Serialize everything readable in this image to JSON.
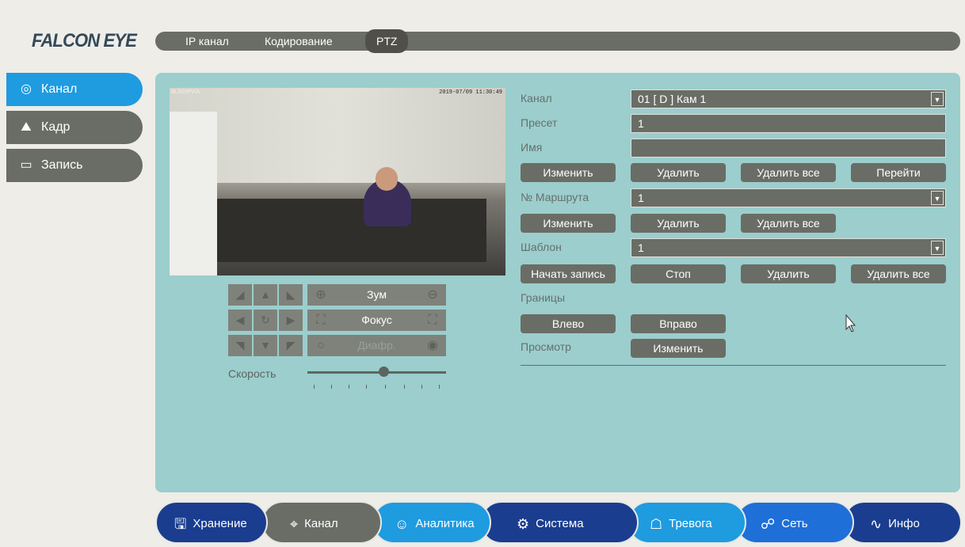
{
  "brand": "FALCON EYE",
  "top_tabs": [
    {
      "label": "IP канал"
    },
    {
      "label": "Кодирование"
    },
    {
      "label": "PTZ"
    }
  ],
  "sidebar": [
    {
      "label": "Канал",
      "icon": "camera-icon",
      "active": true
    },
    {
      "label": "Кадр",
      "icon": "image-icon",
      "active": false
    },
    {
      "label": "Запись",
      "icon": "video-record-icon",
      "active": false
    }
  ],
  "video": {
    "camera_name": "BL500PV/A",
    "timestamp": "2019-07/09 11:30:49"
  },
  "ptz": {
    "zoom_label": "Зум",
    "focus_label": "Фокус",
    "iris_label": "Диафр.",
    "speed_label": "Скорость",
    "speed_value": 0.55
  },
  "form": {
    "channel_label": "Канал",
    "channel_value": "01 [ D ] Кам 1",
    "preset_label": "Пресет",
    "preset_value": "1",
    "name_label": "Имя",
    "name_value": "",
    "preset_buttons": [
      "Изменить",
      "Удалить",
      "Удалить все",
      "Перейти"
    ],
    "route_label": "№ Маршрута",
    "route_value": "1",
    "route_buttons": [
      "Изменить",
      "Удалить",
      "Удалить все"
    ],
    "pattern_label": "Шаблон",
    "pattern_value": "1",
    "pattern_buttons": [
      "Начать запись",
      "Стоп",
      "Удалить",
      "Удалить все"
    ],
    "limits_label": "Границы",
    "limits_buttons": [
      "Влево",
      "Вправо"
    ],
    "view_label": "Просмотр",
    "view_button": "Изменить"
  },
  "bottom_nav": [
    {
      "label": "Хранение",
      "icon": "save-icon",
      "color": "#1a3d8f"
    },
    {
      "label": "Канал",
      "icon": "camera-icon",
      "color": "#6a6d65"
    },
    {
      "label": "Аналитика",
      "icon": "brain-icon",
      "color": "#1f9be0"
    },
    {
      "label": "Система",
      "icon": "gear-icon",
      "color": "#1a3d8f"
    },
    {
      "label": "Тревога",
      "icon": "alarm-icon",
      "color": "#1f9be0"
    },
    {
      "label": "Сеть",
      "icon": "network-icon",
      "color": "#1f6fd8"
    },
    {
      "label": "Инфо",
      "icon": "pulse-icon",
      "color": "#1a3d8f"
    }
  ]
}
